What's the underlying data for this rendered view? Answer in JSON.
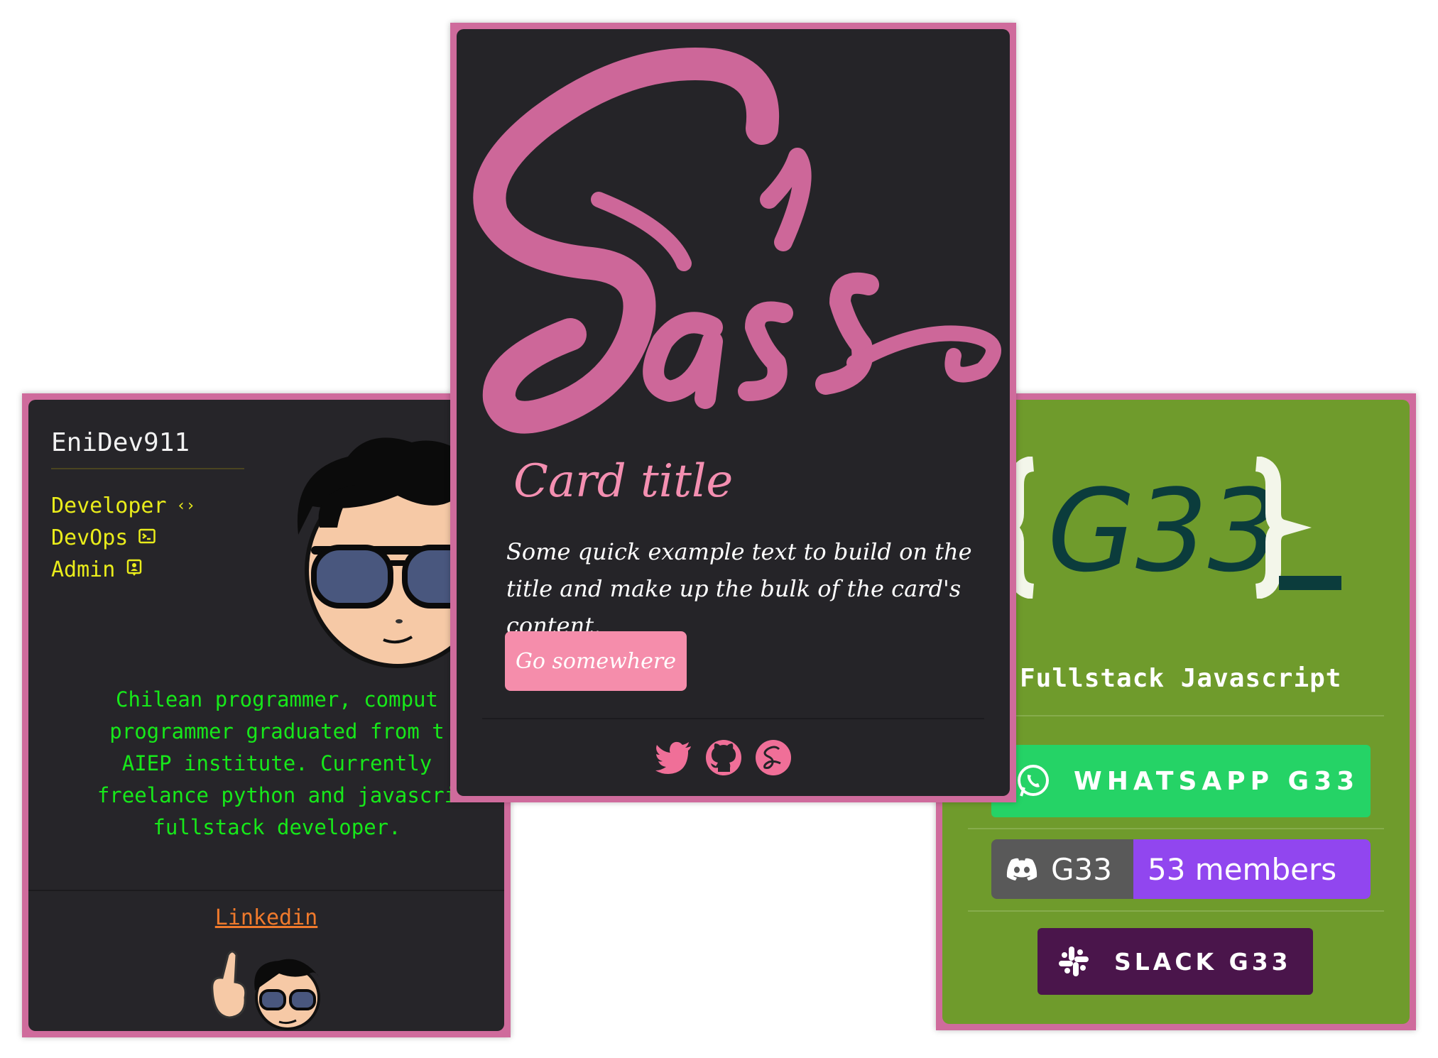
{
  "left_card": {
    "name": "EniDev911",
    "roles": [
      {
        "label": "Developer",
        "icon": "code-icon"
      },
      {
        "label": "DevOps",
        "icon": "terminal-icon"
      },
      {
        "label": "Admin",
        "icon": "person-badge-icon"
      }
    ],
    "bio_lines": [
      "Chilean programmer, comput",
      "programmer graduated from t",
      "AIEP institute. Currently",
      "freelance python and javascri",
      "fullstack developer."
    ],
    "link_label": "Linkedin"
  },
  "center_card": {
    "logo_text": "Sass",
    "title": "Card title",
    "text": "Some quick example text to build on the title and make up the bulk of the card's content.",
    "button_label": "Go somewhere",
    "social_icons": [
      "twitter-icon",
      "github-icon",
      "sass-icon"
    ]
  },
  "right_card": {
    "logo_text": "{G33}_",
    "subtitle": "Fullstack Javascript",
    "whatsapp_label": "WHATSAPP G33",
    "discord_label": "G33",
    "discord_members": "53 members",
    "slack_label": "SLACK G33"
  },
  "colors": {
    "card_border": "#cf6b9c",
    "dark_bg": "#262529",
    "sass_pink": "#cd6799",
    "yellow": "#e9ec1b",
    "green_text": "#17e81a",
    "orange_link": "#f07a2c",
    "g33_green": "#6f9b2c",
    "whatsapp": "#25d366",
    "discord_purple": "#9146ef",
    "slack_purple": "#4a154b"
  }
}
